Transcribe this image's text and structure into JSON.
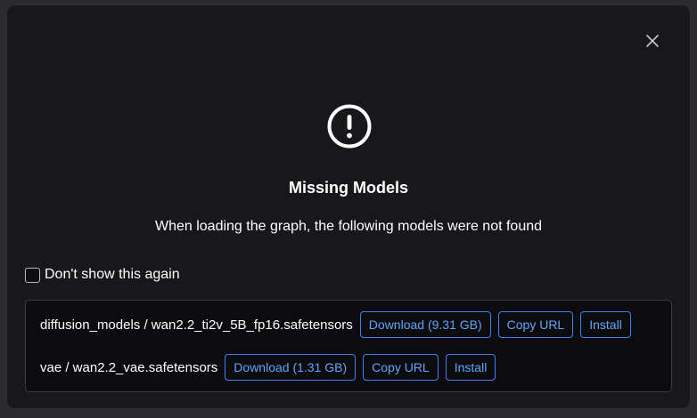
{
  "dialog": {
    "title": "Missing Models",
    "message": "When loading the graph, the following models were not found",
    "close_icon": "close-icon",
    "warning_icon": "exclamation-circle-icon",
    "dont_show_label": "Don't show this again",
    "dont_show_checked": false
  },
  "models": [
    {
      "name": "diffusion_models / wan2.2_ti2v_5B_fp16.safetensors",
      "download_label": "Download (9.31 GB)",
      "copy_label": "Copy URL",
      "install_label": "Install"
    },
    {
      "name": "vae / wan2.2_vae.safetensors",
      "download_label": "Download (1.31 GB)",
      "copy_label": "Copy URL",
      "install_label": "Install"
    }
  ],
  "colors": {
    "background": "#18181b",
    "list_background": "#0c0c0e",
    "accent": "#3b82f6",
    "accent_text": "#60a5fa",
    "text": "#ffffff"
  }
}
